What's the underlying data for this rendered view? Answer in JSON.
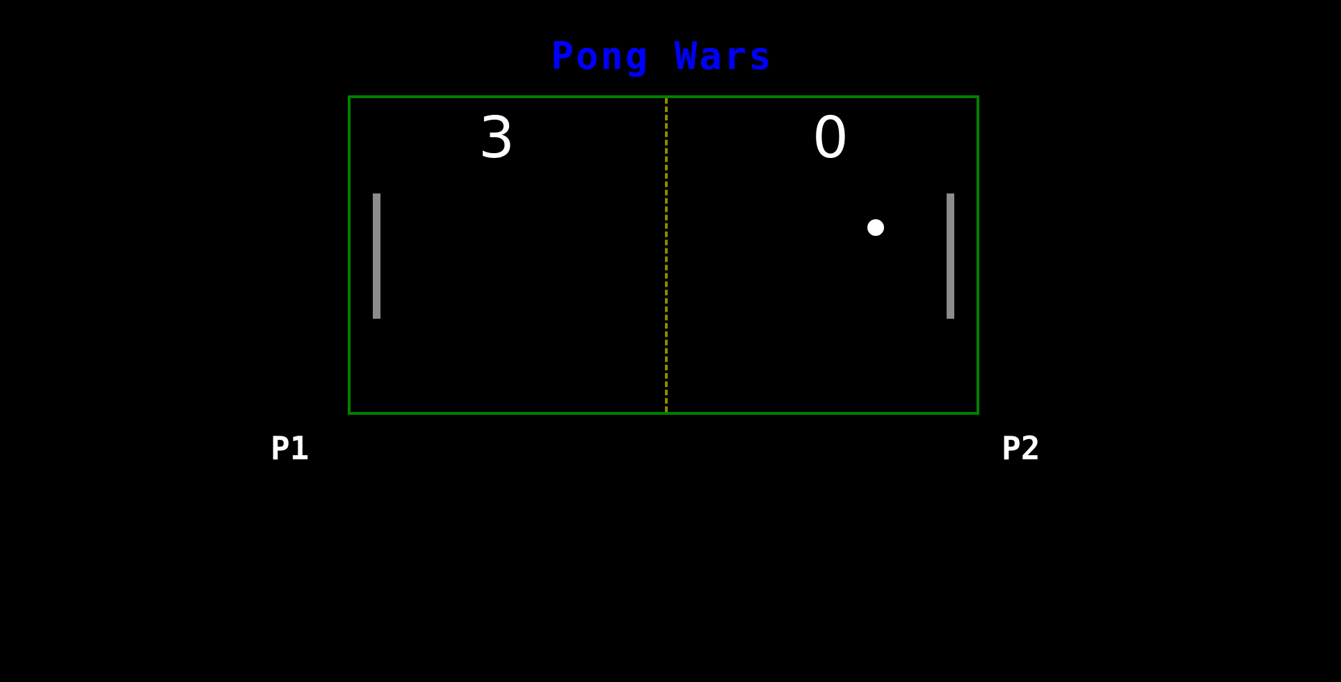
{
  "game": {
    "title": "Pong Wars",
    "scores": {
      "left": "3",
      "right": "0"
    },
    "players": {
      "left": "P1",
      "right": "P2"
    },
    "colors": {
      "background": "#000000",
      "title": "#0000ff",
      "court_border": "#008000",
      "center_line": "#8b8b00",
      "paddle": "#8c8c8c",
      "ball": "#ffffff",
      "text": "#ffffff"
    }
  }
}
